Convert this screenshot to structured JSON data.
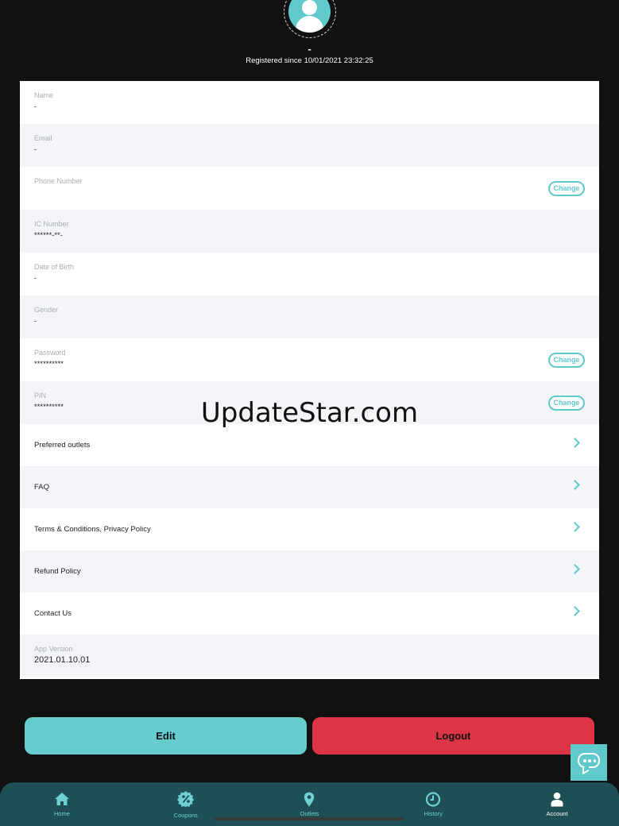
{
  "profile": {
    "name": "-",
    "registered": "Registered since 10/01/2021 23:32:25"
  },
  "fields": [
    {
      "label": "Name",
      "value": "-"
    },
    {
      "label": "Email",
      "value": "-"
    },
    {
      "label": "Phone Number",
      "value": "",
      "action": "Change"
    },
    {
      "label": "IC Number",
      "value": "******-**-"
    },
    {
      "label": "Date of Birth",
      "value": "-"
    },
    {
      "label": "Gender",
      "value": "-"
    },
    {
      "label": "Password",
      "value": "**********",
      "action": "Change"
    },
    {
      "label": "PIN",
      "value": "**********",
      "action": "Change"
    }
  ],
  "links": [
    {
      "label": "Preferred outlets"
    },
    {
      "label": "FAQ"
    },
    {
      "label": "Terms & Conditions, Privacy Policy"
    },
    {
      "label": "Refund Policy"
    },
    {
      "label": "Contact Us"
    }
  ],
  "app_version": {
    "label": "App Version",
    "value": "2021.01.10.01"
  },
  "watermark": "UpdateStar.com",
  "buttons": {
    "edit": "Edit",
    "logout": "Logout"
  },
  "tabs": [
    {
      "label": "Home",
      "icon": "home-icon"
    },
    {
      "label": "Coupons",
      "icon": "coupon-icon"
    },
    {
      "label": "Outlets",
      "icon": "map-pin-icon"
    },
    {
      "label": "History",
      "icon": "clock-icon"
    },
    {
      "label": "Account",
      "icon": "user-icon",
      "active": true
    }
  ],
  "colors": {
    "accent": "#5fc9cc",
    "logout": "#dd3545",
    "tabbar": "#1e4f54",
    "background": "#111111"
  }
}
